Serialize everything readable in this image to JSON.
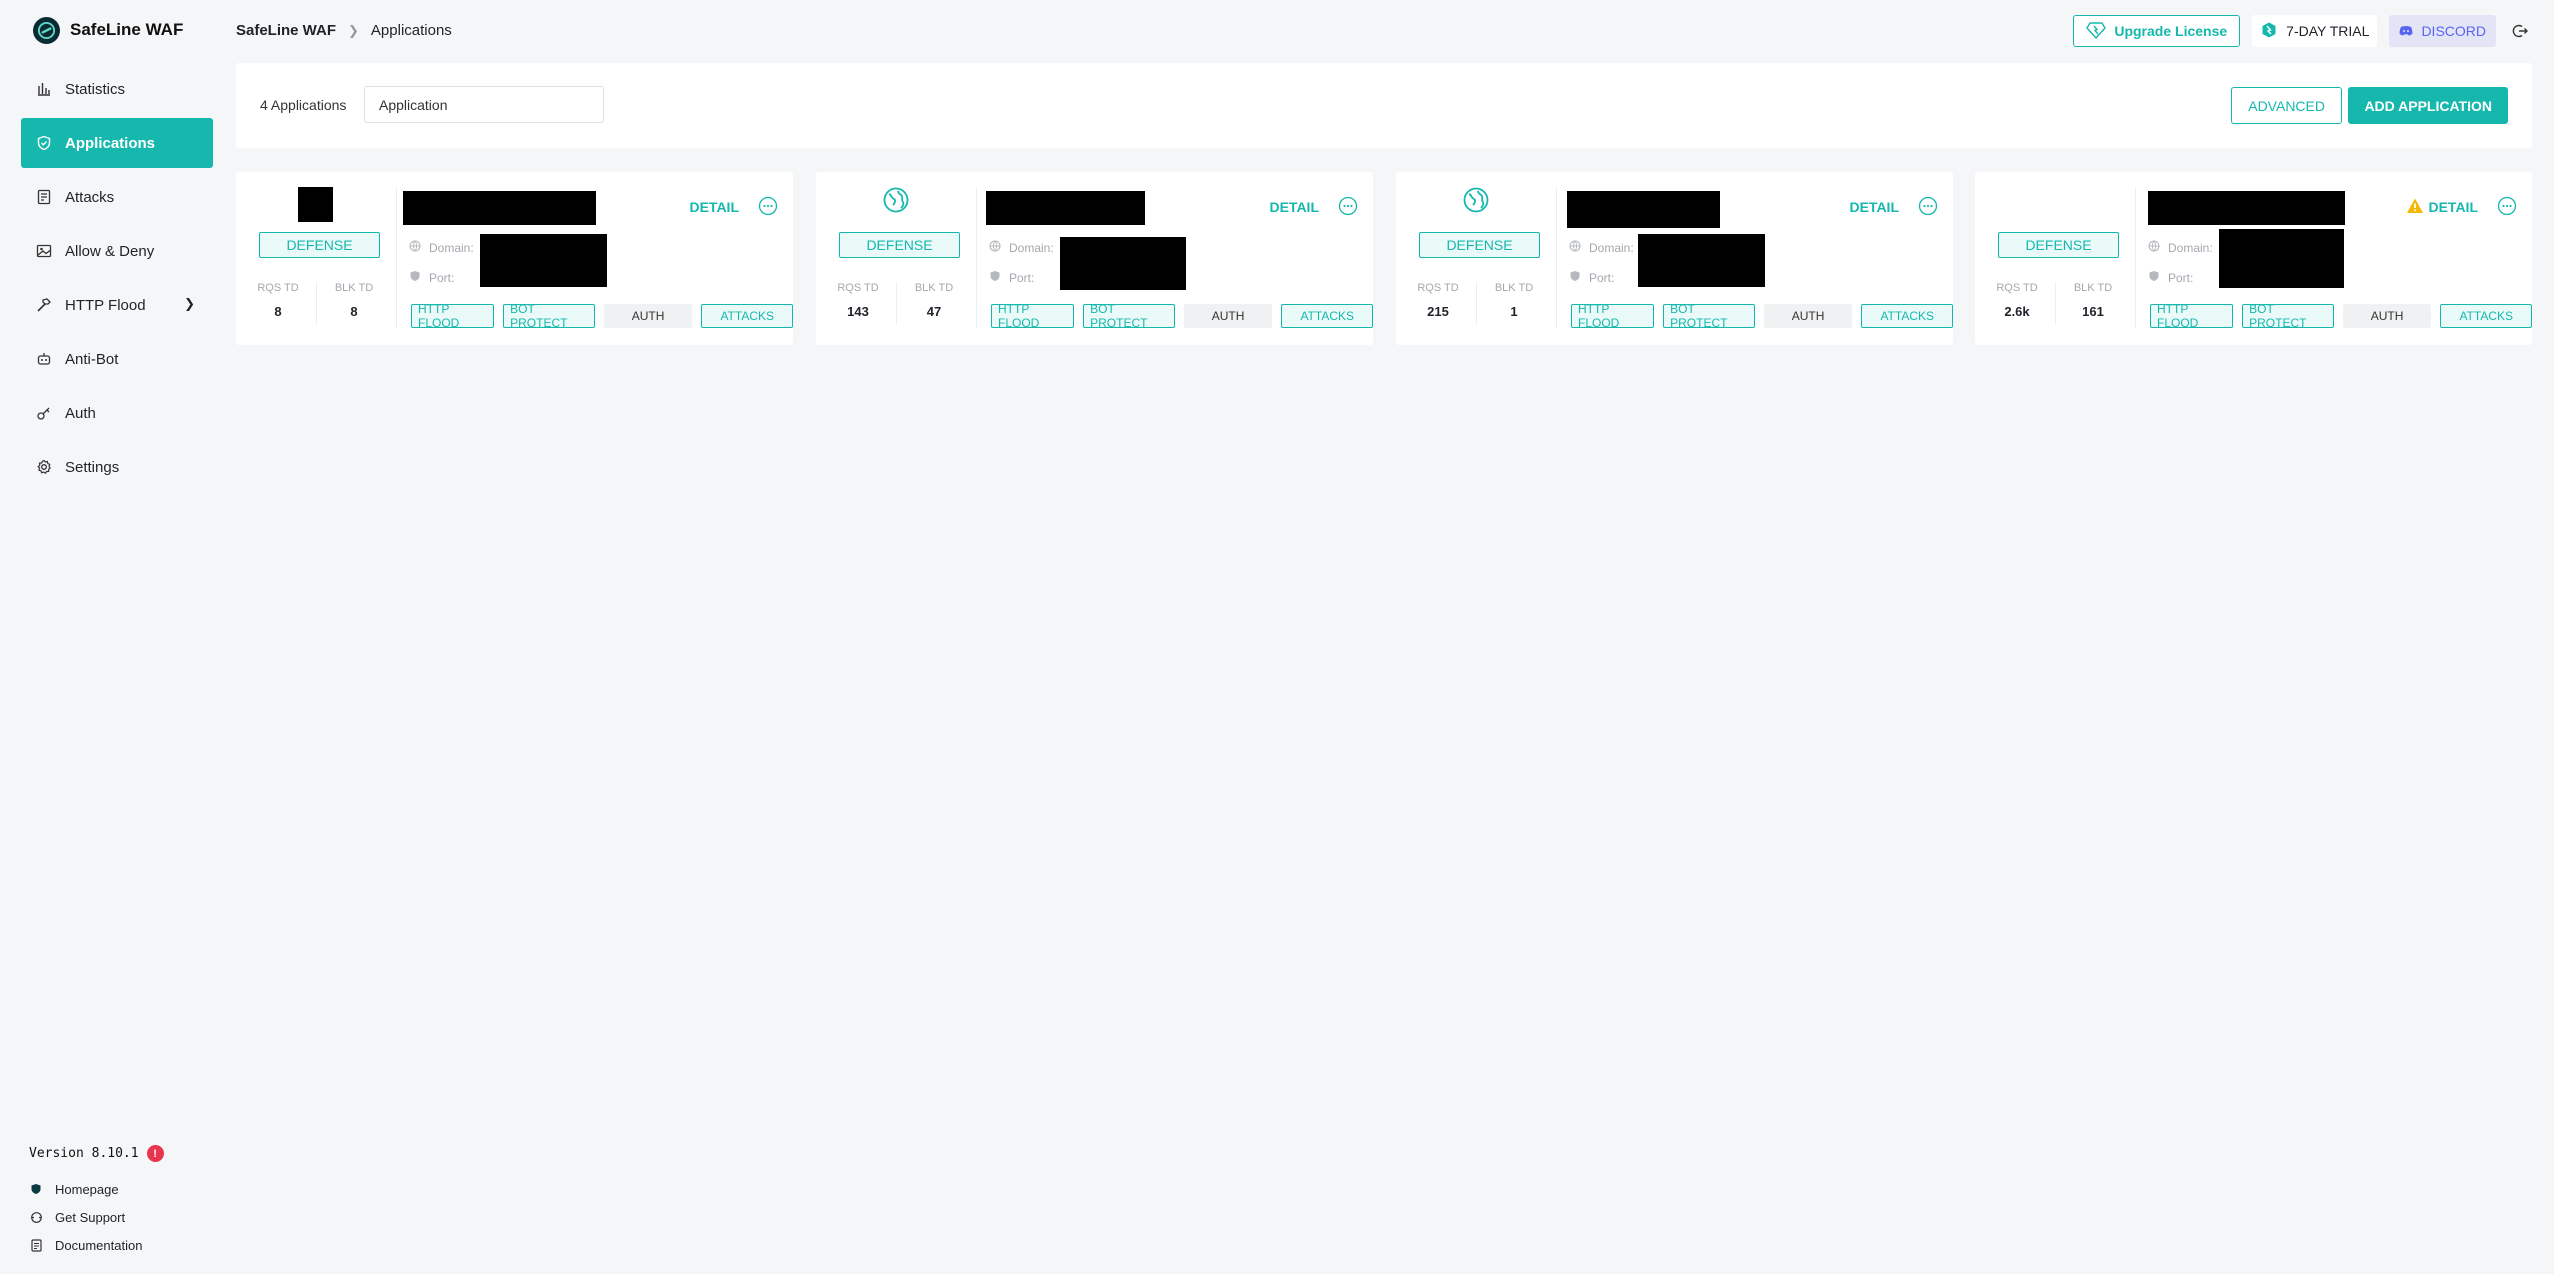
{
  "brand": {
    "name": "SafeLine WAF"
  },
  "sidebar": {
    "items": [
      {
        "label": "Statistics",
        "icon": "bar-chart-icon"
      },
      {
        "label": "Applications",
        "icon": "shield-icon",
        "active": true
      },
      {
        "label": "Attacks",
        "icon": "document-icon"
      },
      {
        "label": "Allow & Deny",
        "icon": "image-icon"
      },
      {
        "label": "HTTP Flood",
        "icon": "hammer-icon"
      },
      {
        "label": "Anti-Bot",
        "icon": "robot-icon"
      },
      {
        "label": "Auth",
        "icon": "key-icon"
      },
      {
        "label": "Settings",
        "icon": "gear-icon"
      }
    ],
    "version": "Version 8.10.1",
    "version_badge": "!",
    "footer": [
      {
        "label": "Homepage"
      },
      {
        "label": "Get Support"
      },
      {
        "label": "Documentation"
      }
    ]
  },
  "header": {
    "breadcrumb_root": "SafeLine WAF",
    "breadcrumb_current": "Applications",
    "upgrade_label": "Upgrade License",
    "trial_label": "7-DAY TRIAL",
    "discord_label": "DISCORD"
  },
  "toolbar": {
    "count_label": "4 Applications",
    "search_value": "Application",
    "advanced_label": "ADVANCED",
    "add_label": "ADD APPLICATION"
  },
  "card_common": {
    "defense_label": "DEFENSE",
    "rqs_label": "RQS TD",
    "blk_label": "BLK TD",
    "detail_label": "DETAIL",
    "domain_label": "Domain:",
    "port_label": "Port:",
    "tags": [
      "HTTP FLOOD",
      "BOT PROTECT",
      "AUTH",
      "ATTACKS"
    ]
  },
  "cards": [
    {
      "icon": "redacted-icon",
      "rqs": "8",
      "blk": "8",
      "warning": false
    },
    {
      "icon": "globe-icon",
      "rqs": "143",
      "blk": "47",
      "warning": false
    },
    {
      "icon": "globe-icon",
      "rqs": "215",
      "blk": "1",
      "warning": false
    },
    {
      "icon": "none",
      "rqs": "2.6k",
      "blk": "161",
      "warning": true
    }
  ],
  "colors": {
    "accent": "#16b8ad",
    "active_nav": "#16b8ad",
    "discord": "#5865f2",
    "warning": "#f5b800",
    "badge": "#e8344e"
  }
}
